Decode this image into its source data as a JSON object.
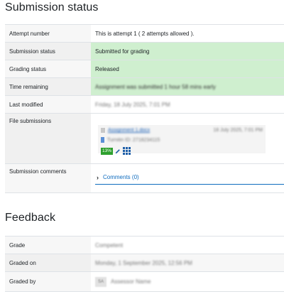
{
  "submission": {
    "title": "Submission status",
    "rows": {
      "attempt_number": {
        "label": "Attempt number",
        "value": "This is attempt 1 ( 2 attempts allowed )."
      },
      "submission_status": {
        "label": "Submission status",
        "value": "Submitted for grading"
      },
      "grading_status": {
        "label": "Grading status",
        "value": "Released"
      },
      "time_remaining": {
        "label": "Time remaining",
        "value": "Assignment was submitted 1 hour 58 mins early"
      },
      "last_modified": {
        "label": "Last modified",
        "value": "Friday, 18 July 2025, 7:01 PM"
      },
      "file_submissions": {
        "label": "File submissions",
        "file_name": "Assignment 1.docx",
        "file_date": "18 July 2025, 7:01 PM",
        "file_id": "Turnitin ID: 2718234115",
        "similarity": "13%"
      },
      "submission_comments": {
        "label": "Submission comments",
        "comments_link": "Comments (0)"
      }
    }
  },
  "feedback": {
    "title": "Feedback",
    "rows": {
      "grade": {
        "label": "Grade",
        "value": "Competent"
      },
      "graded_on": {
        "label": "Graded on",
        "value": "Monday, 1 September 2025, 12:56 PM"
      },
      "graded_by": {
        "label": "Graded by",
        "avatar_initials": "SA",
        "value": "Assessor Name"
      }
    }
  },
  "colors": {
    "submitted_bg": "#cfefcf",
    "similarity_badge": "#2ea02e",
    "link": "#0f6cbf"
  },
  "icons": {
    "file": "file-icon",
    "turnitin_flag": "flag-icon",
    "edit": "pencil-icon",
    "grid": "grid-icon",
    "expand": "chevron-right-icon"
  }
}
